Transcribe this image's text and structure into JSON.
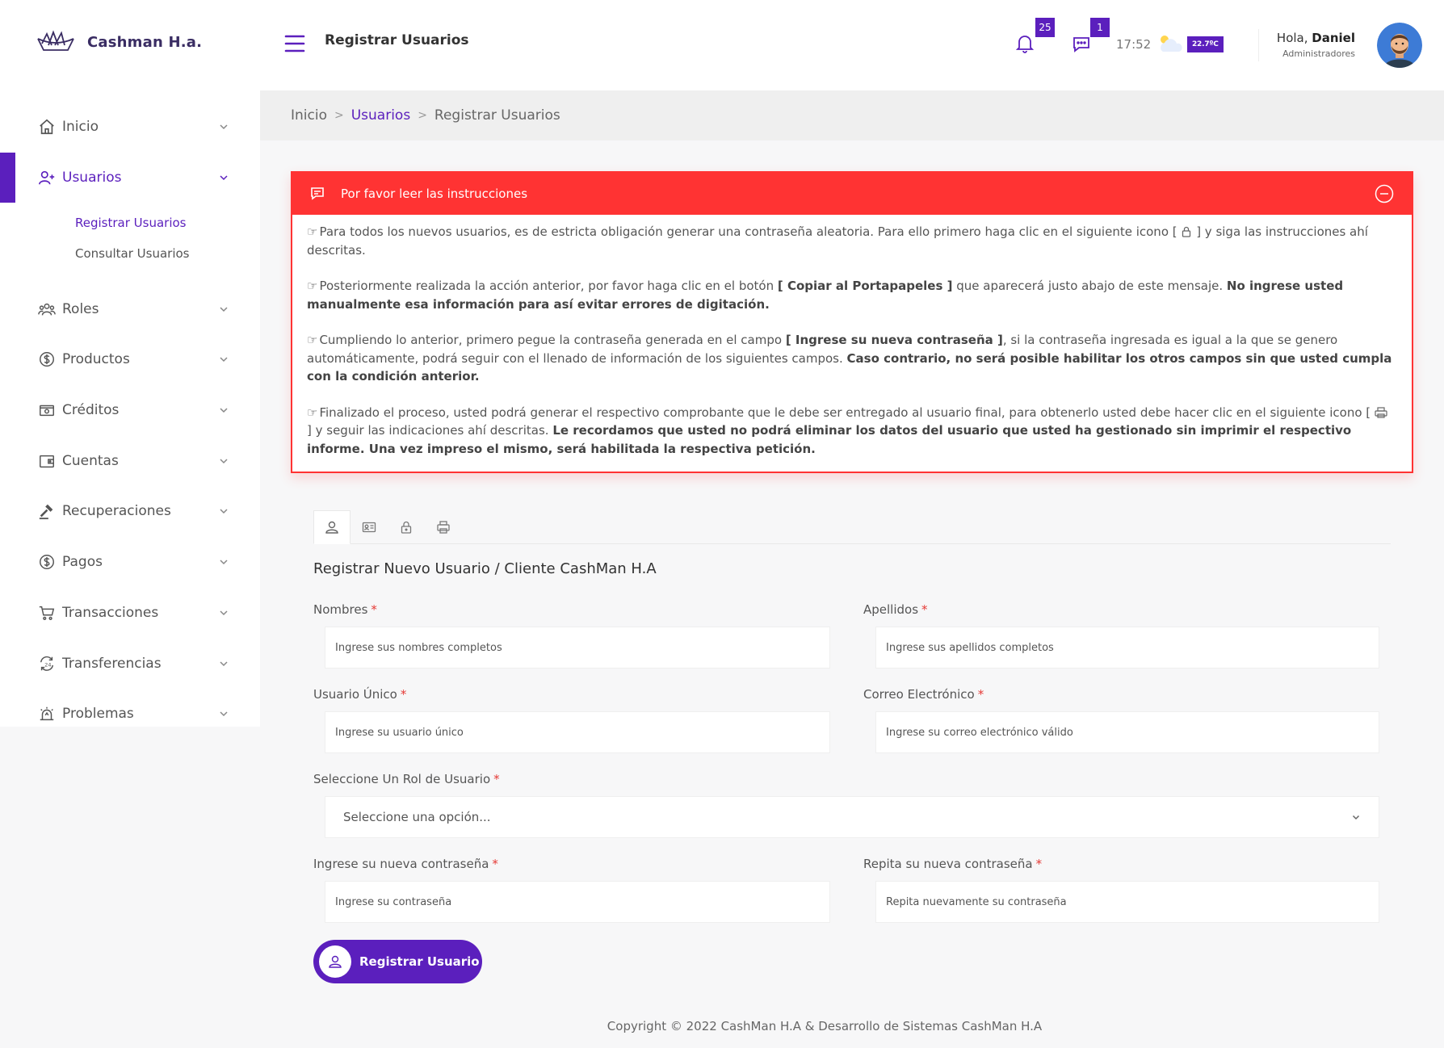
{
  "brand": {
    "name": "Cashman H.a."
  },
  "sidebar": {
    "items": [
      {
        "label": "Inicio",
        "icon": "home-icon"
      },
      {
        "label": "Usuarios",
        "icon": "user-add-icon"
      },
      {
        "label": "Roles",
        "icon": "users-group-icon"
      },
      {
        "label": "Productos",
        "icon": "dollar-circle-icon"
      },
      {
        "label": "Créditos",
        "icon": "wallet-icon"
      },
      {
        "label": "Cuentas",
        "icon": "account-card-icon"
      },
      {
        "label": "Recuperaciones",
        "icon": "gavel-icon"
      },
      {
        "label": "Pagos",
        "icon": "dollar-circle-icon"
      },
      {
        "label": "Transacciones",
        "icon": "cart-icon"
      },
      {
        "label": "Transferencias",
        "icon": "transfer-24-icon"
      },
      {
        "label": "Problemas",
        "icon": "alarm-icon"
      }
    ],
    "subitems": [
      "Registrar Usuarios",
      "Consultar Usuarios"
    ]
  },
  "header": {
    "title": "Registrar Usuarios",
    "notifications_count": "25",
    "messages_count": "1",
    "time": "17:52",
    "temperature": "22.7ºC",
    "greeting_prefix": "Hola, ",
    "user_name": "Daniel",
    "user_role": "Administradores"
  },
  "breadcrumb": {
    "home": "Inicio",
    "section": "Usuarios",
    "current": "Registrar Usuarios",
    "sep": ">"
  },
  "alert": {
    "title": "Por favor leer las instrucciones",
    "p1": "Para todos los nuevos usuarios, es de estricta obligación generar una contraseña aleatoria. Para ello primero haga clic en el siguiente icono [",
    "p1b": "] y siga las instrucciones ahí descritas.",
    "p2a": "Posteriormente realizada la acción anterior, por favor haga clic en el botón ",
    "p2b": "[ Copiar al Portapapeles ]",
    "p2c": " que aparecerá justo abajo de este mensaje. ",
    "p2d": "No ingrese usted manualmente esa información para así evitar errores de digitación.",
    "p3a": "Cumpliendo lo anterior, primero pegue la contraseña generada en el campo ",
    "p3b": "[ Ingrese su nueva contraseña ]",
    "p3c": ", si la contraseña ingresada es igual a la que se genero automáticamente, podrá seguir con el llenado de información de los siguientes campos. ",
    "p3d": "Caso contrario, no será posible habilitar los otros campos sin que usted cumpla con la condición anterior.",
    "p4a": "Finalizado el proceso, usted podrá generar el respectivo comprobante que le debe ser entregado al usuario final, para obtenerlo usted debe hacer clic en el siguiente icono [",
    "p4b": "] y seguir las indicaciones ahí descritas. ",
    "p4c": "Le recordamos que usted no podrá eliminar los datos del usuario que usted ha gestionado sin imprimir el respectivo informe. Una vez impreso el mismo, será habilitada la respectiva petición."
  },
  "form": {
    "title": "Registrar Nuevo Usuario / Cliente CashMan H.A",
    "required_mark": "*",
    "nombres_label": "Nombres",
    "nombres_placeholder": "Ingrese sus nombres completos",
    "apellidos_label": "Apellidos",
    "apellidos_placeholder": "Ingrese sus apellidos completos",
    "usuario_label": "Usuario Único",
    "usuario_placeholder": "Ingrese su usuario único",
    "correo_label": "Correo Electrónico",
    "correo_placeholder": "Ingrese su correo electrónico válido",
    "rol_label": "Seleccione Un Rol de Usuario",
    "rol_selected": "Seleccione una opción...",
    "pass_label": "Ingrese su nueva contraseña",
    "pass_placeholder": "Ingrese su contraseña",
    "repass_label": "Repita su nueva contraseña",
    "repass_placeholder": "Repita nuevamente su contraseña",
    "submit_label": "Registrar Usuario"
  },
  "footer": {
    "text": "Copyright © 2022 CashMan H.A & Desarrollo de Sistemas CashMan H.A"
  },
  "colors": {
    "accent": "#5b1fbd",
    "alert": "#ff3333"
  }
}
